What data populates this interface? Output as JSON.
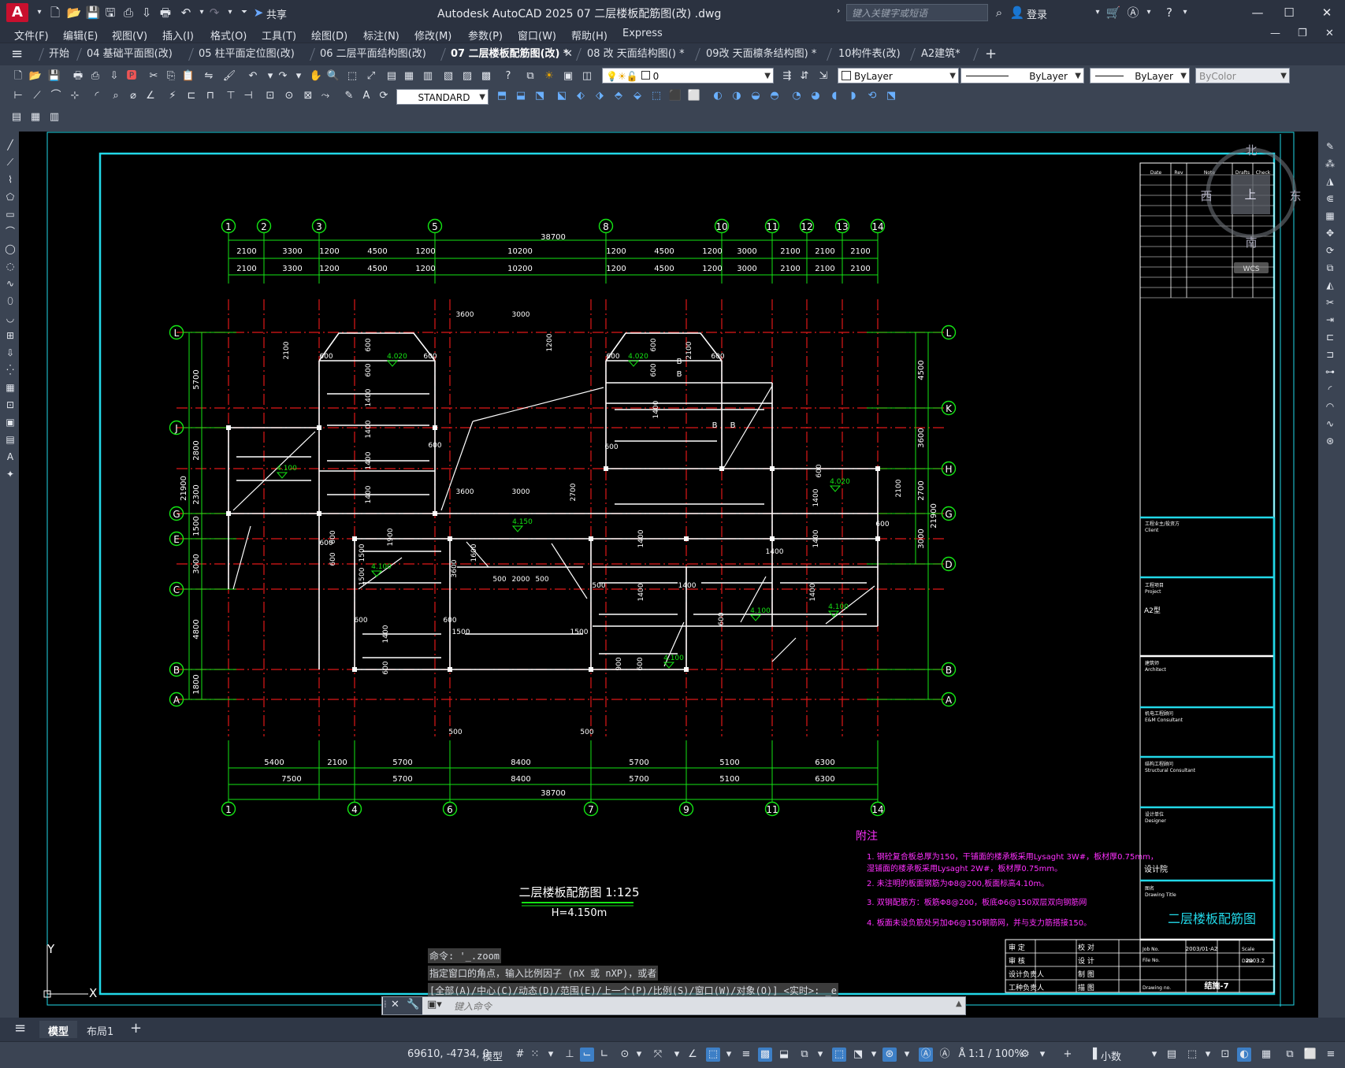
{
  "app": {
    "title": "Autodesk AutoCAD 2025    07 二层楼板配筋图(改) .dwg",
    "share_label": "共享",
    "search_placeholder": "键入关键字或短语",
    "login_label": "登录"
  },
  "menu": [
    "文件(F)",
    "编辑(E)",
    "视图(V)",
    "插入(I)",
    "格式(O)",
    "工具(T)",
    "绘图(D)",
    "标注(N)",
    "修改(M)",
    "参数(P)",
    "窗口(W)",
    "帮助(H)",
    "Express"
  ],
  "tabs": [
    {
      "label": "开始"
    },
    {
      "label": "04 基础平面图(改)"
    },
    {
      "label": "05 柱平面定位图(改)"
    },
    {
      "label": "06 二层平面结构图(改)"
    },
    {
      "label": "07 二层楼板配筋图(改) *",
      "active": true
    },
    {
      "label": "08 改 天面结构图() *"
    },
    {
      "label": "09改 天面檩条结构图) *"
    },
    {
      "label": "10构件表(改)"
    },
    {
      "label": "A2建筑*"
    }
  ],
  "properties": {
    "layer": "0",
    "color": "ByLayer",
    "linetype": "ByLayer",
    "lineweight": "ByLayer",
    "plotstyle": "ByColor",
    "text_style": "STANDARD"
  },
  "viewcube": {
    "north": "北",
    "south": "南",
    "east": "东",
    "west": "西",
    "top": "上",
    "wcs": "WCS"
  },
  "drawing": {
    "title": "二层楼板配筋图 1:125",
    "elevation": "H=4.150m",
    "top_axes": [
      "1",
      "2",
      "3",
      "5",
      "8",
      "10",
      "11",
      "12",
      "13",
      "14"
    ],
    "bottom_axes": [
      "1",
      "4",
      "6",
      "7",
      "9",
      "11",
      "14"
    ],
    "left_axes": [
      "L",
      "J",
      "G",
      "E",
      "C",
      "B",
      "A"
    ],
    "right_axes": [
      "L",
      "K",
      "H",
      "G",
      "D",
      "B",
      "A"
    ],
    "top_dims_row1": [
      "2100",
      "3300",
      "1200",
      "4500",
      "1200",
      "10200",
      "1200",
      "4500",
      "1200",
      "3000",
      "2100",
      "2100",
      "2100"
    ],
    "top_dims_row2": [
      "2100",
      "3300",
      "1200",
      "4500",
      "1200",
      "10200",
      "1200",
      "4500",
      "1200",
      "3000",
      "2100",
      "2100",
      "2100"
    ],
    "top_total": "38700",
    "bottom_dims_row1": [
      "5400",
      "2100",
      "5700",
      "8400",
      "5700",
      "5100",
      "6300"
    ],
    "bottom_dims_row2": [
      "7500",
      "5700",
      "8400",
      "5700",
      "5100",
      "6300"
    ],
    "bottom_total": "38700",
    "left_dims": [
      "5700",
      "2800",
      "2300",
      "1500",
      "3000",
      "4800",
      "1800"
    ],
    "left_total": "21900",
    "right_dims": [
      "4500",
      "3600",
      "2700",
      "3000"
    ],
    "right_total": "21900",
    "notes_title": "附注",
    "notes": [
      "1. 钢砼复合板总厚为150，干铺面的楼承板采用Lysaght 3W#，板材厚0.75mm，",
      "    湿铺面的楼承板采用Lysaght 2W#，板材厚0.75mm。",
      "2. 未注明的板面钢筋为Φ8@200,板面标高4.10m。",
      "3. 双钢配筋方：板筋Φ8@200，板底Φ6@150双层双向钢筋网",
      "4. 板面未设负筋处另加Φ6@150钢筋网，并与支力筋搭接150。"
    ],
    "slab_labels": [
      "4.020",
      "4.020",
      "4.100",
      "4.150",
      "4.020",
      "4.100",
      "4.100",
      "4.100",
      "4.100"
    ]
  },
  "title_block": {
    "rev_headers": [
      "Date",
      "Rev",
      "Note",
      "Drafts",
      "Check"
    ],
    "client": "工程业主/投资方\nClient",
    "project_label": "工程项目\nProject",
    "project_value": "A2型",
    "architect": "建筑师\nArchitect",
    "consultant": "机电工程顾问\nE&M Consultant",
    "structural": "结构工程顾问\nStructural Consultant",
    "designer": "设计单位\nDesigner",
    "designer_value": "设计院",
    "drawing_title_label": "图名\nDrawing Title",
    "drawing_title": "二层楼板配筋图",
    "signoffs": [
      [
        "审 定",
        "校 对"
      ],
      [
        "审 核",
        "设 计"
      ],
      [
        "设计负责人",
        "制 图"
      ],
      [
        "工种负责人",
        "描 图"
      ]
    ],
    "job_no_label": "Job No.",
    "job_no": "2003/01-A2",
    "scale_label": "Scale",
    "file_no_label": "File No.",
    "date_label": "Date",
    "date": "2003.2",
    "drawing_no_label": "Drawing no.",
    "drawing_no": "结施-7"
  },
  "command": {
    "history": [
      "命令: '_.zoom",
      "指定窗口的角点，输入比例因子 (nX 或 nXP)，或者",
      "[全部(A)/中心(C)/动态(D)/范围(E)/上一个(P)/比例(S)/窗口(W)/对象(O)] <实时>: _e"
    ],
    "placeholder": "键入命令"
  },
  "layouts": [
    {
      "label": "模型",
      "active": true
    },
    {
      "label": "布局1"
    }
  ],
  "status": {
    "coords": "69610, -4734, 0",
    "model_label": "模型",
    "scale": "1:1 / 100%",
    "units": "小数"
  },
  "ucs": {
    "y": "Y",
    "x": "X"
  }
}
